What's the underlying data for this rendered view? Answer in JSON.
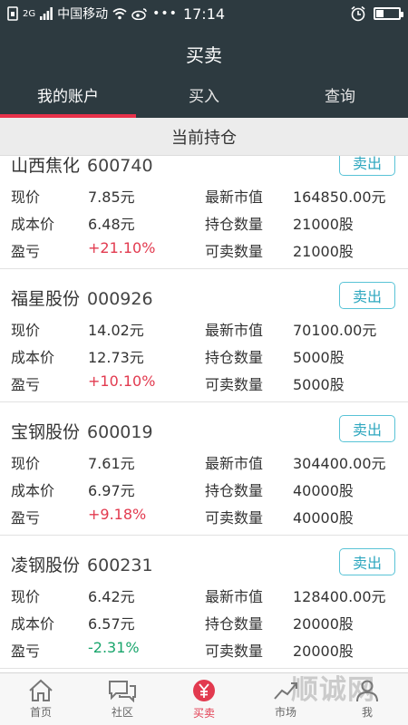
{
  "status_bar": {
    "network": "2G",
    "carrier": "中国移动",
    "time": "17:14"
  },
  "app_bar": {
    "title": "买卖"
  },
  "tabs": [
    {
      "label": "我的账户",
      "active": true
    },
    {
      "label": "买入",
      "active": false
    },
    {
      "label": "查询",
      "active": false
    }
  ],
  "section": {
    "title": "当前持仓"
  },
  "holdings": [
    {
      "name": "山西焦化",
      "code": "600740",
      "sell_label": "卖出",
      "current_price_label": "现价",
      "current_price": "7.85元",
      "cost_label": "成本价",
      "cost": "6.48元",
      "pl_label": "盈亏",
      "pl": "+21.10%",
      "market_value_label": "最新市值",
      "market_value": "164850.00元",
      "holding_qty_label": "持仓数量",
      "holding_qty": "21000股",
      "sellable_qty_label": "可卖数量",
      "sellable_qty": "21000股"
    },
    {
      "name": "福星股份",
      "code": "000926",
      "sell_label": "卖出",
      "current_price_label": "现价",
      "current_price": "14.02元",
      "cost_label": "成本价",
      "cost": "12.73元",
      "pl_label": "盈亏",
      "pl": "+10.10%",
      "market_value_label": "最新市值",
      "market_value": "70100.00元",
      "holding_qty_label": "持仓数量",
      "holding_qty": "5000股",
      "sellable_qty_label": "可卖数量",
      "sellable_qty": "5000股"
    },
    {
      "name": "宝钢股份",
      "code": "600019",
      "sell_label": "卖出",
      "current_price_label": "现价",
      "current_price": "7.61元",
      "cost_label": "成本价",
      "cost": "6.97元",
      "pl_label": "盈亏",
      "pl": "+9.18%",
      "market_value_label": "最新市值",
      "market_value": "304400.00元",
      "holding_qty_label": "持仓数量",
      "holding_qty": "40000股",
      "sellable_qty_label": "可卖数量",
      "sellable_qty": "40000股"
    },
    {
      "name": "凌钢股份",
      "code": "600231",
      "sell_label": "卖出",
      "current_price_label": "现价",
      "current_price": "6.42元",
      "cost_label": "成本价",
      "cost": "6.57元",
      "pl_label": "盈亏",
      "pl": "-2.31%",
      "market_value_label": "最新市值",
      "market_value": "128400.00元",
      "holding_qty_label": "持仓数量",
      "holding_qty": "20000股",
      "sellable_qty_label": "可卖数量",
      "sellable_qty": "20000股"
    }
  ],
  "bottom_nav": [
    {
      "label": "首页",
      "icon": "home-icon",
      "active": false
    },
    {
      "label": "社区",
      "icon": "chat-icon",
      "active": false
    },
    {
      "label": "买卖",
      "icon": "yuan-icon",
      "active": true
    },
    {
      "label": "市场",
      "icon": "chart-icon",
      "active": false
    },
    {
      "label": "我",
      "icon": "user-icon",
      "active": false
    }
  ],
  "watermark": "顺诚网",
  "colors": {
    "header_bg": "#2d3a40",
    "accent_red": "#e8314a",
    "positive": "#e23a4f",
    "negative": "#19a56c",
    "sell_button": "#58c3d6"
  }
}
